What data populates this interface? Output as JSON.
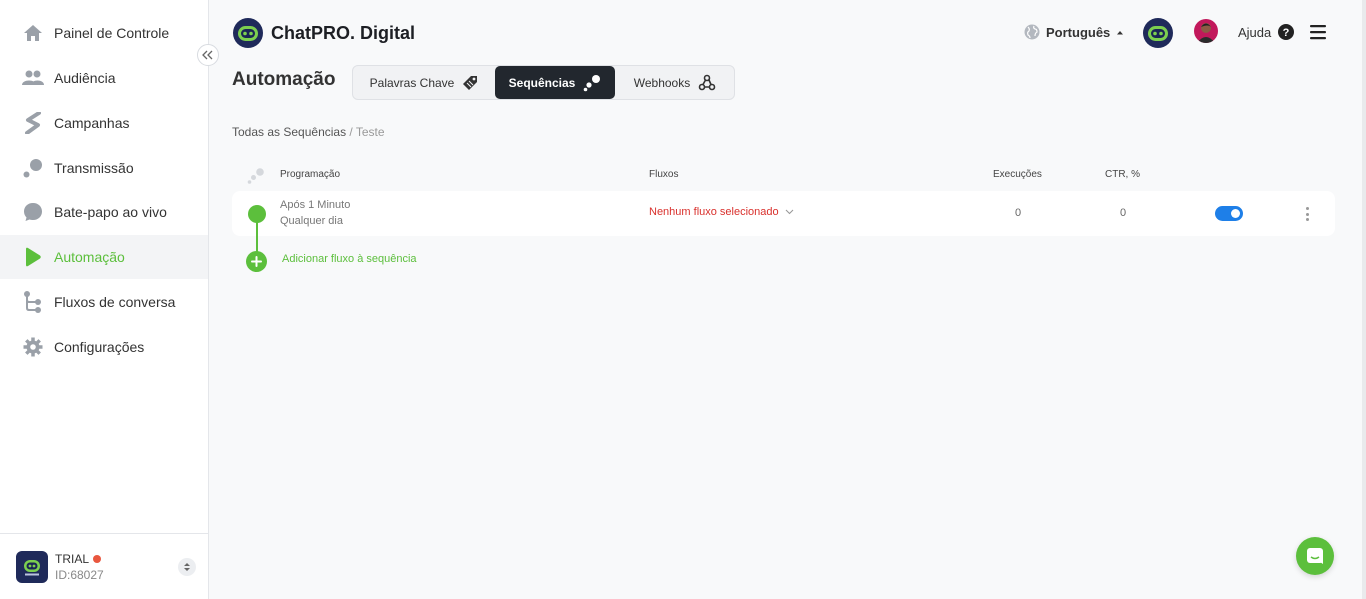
{
  "sidebar": {
    "items": [
      {
        "label": "Painel de Controle",
        "icon": "home-icon"
      },
      {
        "label": "Audiência",
        "icon": "people-icon"
      },
      {
        "label": "Campanhas",
        "icon": "campaign-icon"
      },
      {
        "label": "Transmissão",
        "icon": "broadcast-icon"
      },
      {
        "label": "Bate-papo ao vivo",
        "icon": "chat-icon"
      },
      {
        "label": "Automação",
        "icon": "play-icon",
        "active": true
      },
      {
        "label": "Fluxos de conversa",
        "icon": "flow-icon"
      },
      {
        "label": "Configurações",
        "icon": "gear-icon"
      }
    ],
    "account": {
      "name": "TRIAL",
      "id": "ID:68027"
    }
  },
  "header": {
    "brand": "ChatPRO. Digital",
    "language": "Português",
    "help": "Ajuda"
  },
  "page": {
    "title": "Automação",
    "tabs": [
      {
        "label": "Palavras Chave",
        "icon": "tag-icon"
      },
      {
        "label": "Sequências",
        "icon": "sequence-icon",
        "active": true
      },
      {
        "label": "Webhooks",
        "icon": "webhook-icon"
      }
    ],
    "breadcrumb": {
      "root": "Todas as Sequências",
      "separator": " / ",
      "current": "Teste"
    }
  },
  "table": {
    "columns": {
      "schedule": "Programação",
      "flows": "Fluxos",
      "executions": "Execuções",
      "ctr": "CTR, %"
    },
    "rows": [
      {
        "schedule_line1": "Após 1 Minuto",
        "schedule_line2": "Qualquer dia",
        "flow": "Nenhum fluxo selecionado",
        "executions": "0",
        "ctr": "0",
        "enabled": true
      }
    ],
    "add_label": "Adicionar fluxo à sequência"
  },
  "colors": {
    "accent": "#5cbf3c",
    "dark_tab": "#22272e",
    "toggle": "#1e7fe8",
    "error": "#d9302c"
  }
}
